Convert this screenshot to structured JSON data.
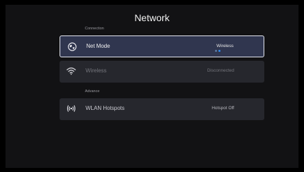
{
  "page": {
    "title": "Network"
  },
  "sections": [
    {
      "label": "Connection"
    },
    {
      "label": "Advance"
    }
  ],
  "items": [
    {
      "label": "Net Mode",
      "value": "Wireless",
      "icon": "globe-icon",
      "selected": true
    },
    {
      "label": "Wireless",
      "value": "Disconnected",
      "icon": "wifi-icon",
      "selected": false
    },
    {
      "label": "WLAN Hotspots",
      "value": "Hotspot Off",
      "icon": "hotspot-icon",
      "selected": false
    }
  ],
  "colors": {
    "background": "#121214",
    "item": "#26272d",
    "selected_item": "#30364f",
    "accent": "#2f8cf0"
  }
}
